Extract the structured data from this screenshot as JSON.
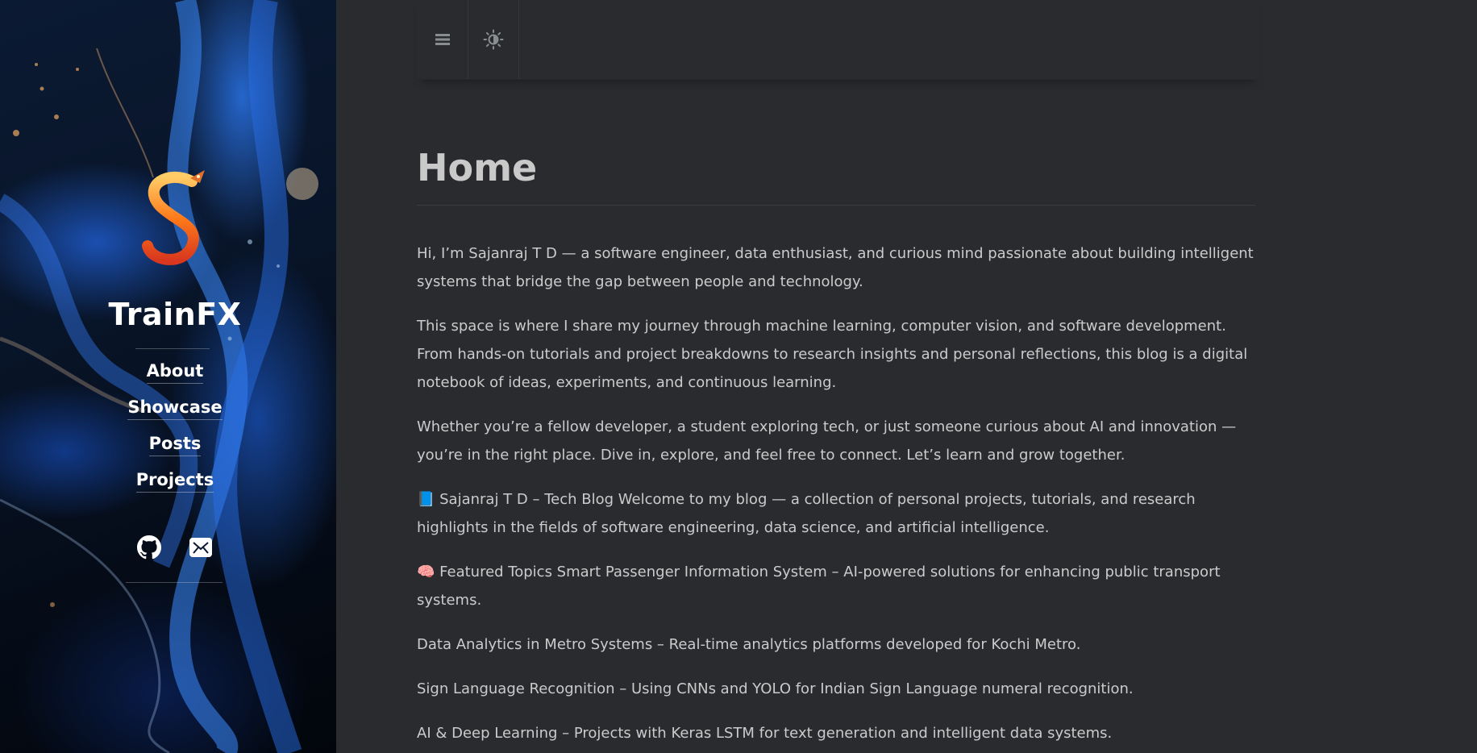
{
  "sidebar": {
    "site_title": "TrainFX",
    "nav": [
      {
        "label": "About"
      },
      {
        "label": "Showcase"
      },
      {
        "label": "Posts"
      },
      {
        "label": "Projects"
      }
    ],
    "social": [
      {
        "icon": "github-icon"
      },
      {
        "icon": "email-icon"
      }
    ]
  },
  "topbar": {
    "menu_icon": "menu-icon",
    "theme_icon": "theme-toggle-icon"
  },
  "main": {
    "title": "Home",
    "paragraphs": [
      "Hi, I’m Sajanraj T D — a software engineer, data enthusiast, and curious mind passionate about building intelligent systems that bridge the gap between people and technology.",
      "This space is where I share my journey through machine learning, computer vision, and software development. From hands-on tutorials and project breakdowns to research insights and personal reflections, this blog is a digital notebook of ideas, experiments, and continuous learning.",
      "Whether you’re a fellow developer, a student exploring tech, or just someone curious about AI and innovation — you’re in the right place. Dive in, explore, and feel free to connect. Let’s learn and grow together.",
      "📘 Sajanraj T D – Tech Blog Welcome to my blog — a collection of personal projects, tutorials, and research highlights in the fields of software engineering, data science, and artificial intelligence.",
      "🧠 Featured Topics Smart Passenger Information System – AI-powered solutions for enhancing public transport systems.",
      "Data Analytics in Metro Systems – Real-time analytics platforms developed for Kochi Metro.",
      "Sign Language Recognition – Using CNNs and YOLO for Indian Sign Language numeral recognition.",
      "AI & Deep Learning – Projects with Keras LSTM for text generation and intelligent data systems."
    ]
  },
  "colors": {
    "background": "#292b2e",
    "text": "#cbcbcb",
    "title": "#c9c9c9",
    "sidebar_text": "#ffffff"
  }
}
